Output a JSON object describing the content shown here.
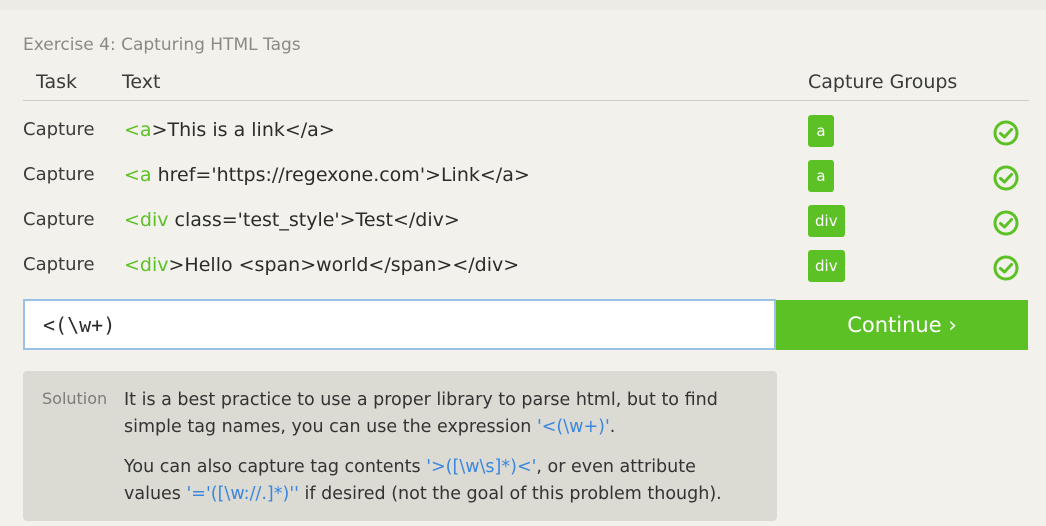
{
  "exercise": {
    "title": "Exercise 4: Capturing HTML Tags"
  },
  "table": {
    "headers": {
      "task": "Task",
      "text": "Text",
      "groups": "Capture Groups"
    },
    "rows": [
      {
        "task": "Capture",
        "highlight": "<a",
        "rest": ">This is a link</a>",
        "group": "a",
        "status": "check-circle-icon"
      },
      {
        "task": "Capture",
        "highlight": "<a",
        "rest": " href='https://regexone.com'>Link</a>",
        "group": "a",
        "status": "check-circle-icon"
      },
      {
        "task": "Capture",
        "highlight": "<div",
        "rest": " class='test_style'>Test</div>",
        "group": "div",
        "status": "check-circle-icon"
      },
      {
        "task": "Capture",
        "highlight": "<div",
        "rest": ">Hello <span>world</span></div>",
        "group": "div",
        "status": "check-circle-icon"
      }
    ]
  },
  "input": {
    "value": "<(\\w+)"
  },
  "continue_label": "Continue ›",
  "solution": {
    "label": "Solution",
    "p1_text": "It is a best practice to use a proper library to parse html, but to find simple tag names, you can use the expression ",
    "p1_code": "'<(\\w+)'",
    "p1_end": ".",
    "p2_text": "You can also capture tag contents ",
    "p2_code1": "'>([\\w\\s]*)<'",
    "p2_mid": ", or even attribute values ",
    "p2_code2": "'='([\\w://.]*)''",
    "p2_end": " if desired (not the goal of this problem though)."
  },
  "colors": {
    "accent": "#5cc125",
    "code": "#3b86e0",
    "input_border": "#9cc1e6"
  }
}
